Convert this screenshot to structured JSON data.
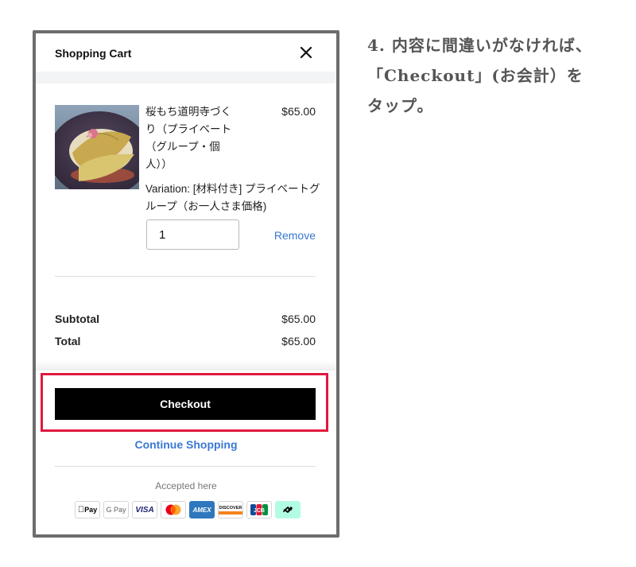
{
  "cart": {
    "title": "Shopping Cart",
    "close_icon": "close-icon"
  },
  "item": {
    "name": "桜もち道明寺づくり（プライベート（グループ・個人））",
    "price": "$65.00",
    "variation": "Variation: [材料付き] プライベートグループ（お一人さま価格)",
    "quantity": "1",
    "remove_label": "Remove"
  },
  "summary": {
    "subtotal_label": "Subtotal",
    "subtotal_value": "$65.00",
    "total_label": "Total",
    "total_value": "$65.00"
  },
  "actions": {
    "checkout_label": "Checkout",
    "continue_label": "Continue Shopping"
  },
  "payments": {
    "accepted_label": "Accepted here",
    "methods": [
      {
        "name": "Apple Pay",
        "icon": "apple-pay-icon",
        "text": "Pay"
      },
      {
        "name": "Google Pay",
        "icon": "google-pay-icon",
        "text": "G Pay"
      },
      {
        "name": "Visa",
        "icon": "visa-icon",
        "text": "VISA"
      },
      {
        "name": "Mastercard",
        "icon": "mastercard-icon"
      },
      {
        "name": "American Express",
        "icon": "amex-icon",
        "text": "AMEX"
      },
      {
        "name": "Discover",
        "icon": "discover-icon",
        "text": "DISCOVER"
      },
      {
        "name": "JCB",
        "icon": "jcb-icon",
        "text": "JCB"
      },
      {
        "name": "Afterpay",
        "icon": "afterpay-icon"
      }
    ]
  },
  "instruction": {
    "line1": "4. 内容に間違いがなければ、",
    "line2": "「Checkout」(お会計）を",
    "line3": "タップ。"
  },
  "colors": {
    "accent_link": "#3a78d4",
    "checkout_bg": "#000000",
    "highlight": "#e0193e",
    "frame": "#6d6d6d"
  }
}
